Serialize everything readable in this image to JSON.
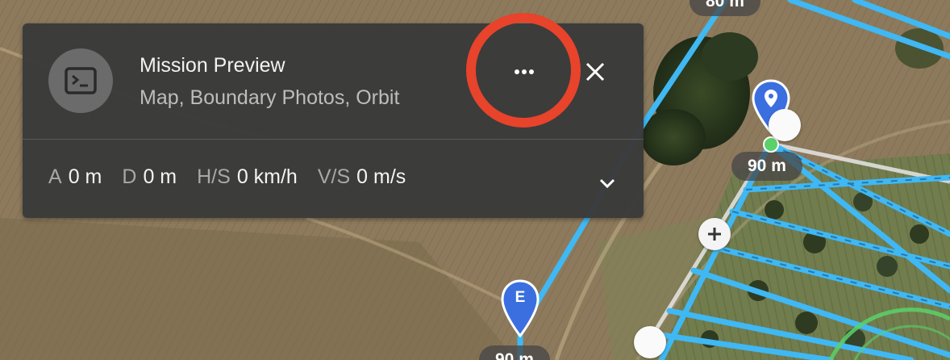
{
  "mission_panel": {
    "icon": "terminal-icon",
    "title": "Mission Preview",
    "subtitle": "Map, Boundary Photos, Orbit",
    "more_icon": "more-horizontal-icon",
    "close_icon": "close-icon",
    "expand_icon": "chevron-down-icon",
    "stats": [
      {
        "key": "A",
        "value": "0 m"
      },
      {
        "key": "D",
        "value": "0 m"
      },
      {
        "key": "H/S",
        "value": "0 km/h"
      },
      {
        "key": "V/S",
        "value": "0 m/s"
      }
    ]
  },
  "map": {
    "altitude_labels": {
      "top": "80 m",
      "waypoint": "90 m",
      "end": "90 m"
    },
    "end_pin_letter": "E",
    "waypoint_pin_icon": "location-pin-icon",
    "add_waypoint_icon": "plus-icon",
    "highlight_color": "#e8432b",
    "path_color": "#3fb8f4",
    "pin_color": "#3b6fe0",
    "home_dot_color": "#5bd16a"
  }
}
